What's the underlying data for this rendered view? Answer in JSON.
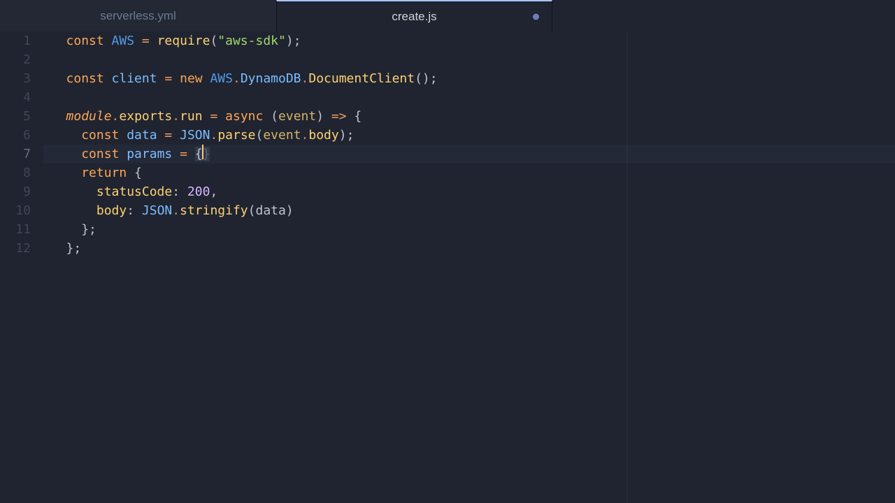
{
  "tabs": [
    {
      "label": "serverless.yml",
      "active": false,
      "dirty": false
    },
    {
      "label": "create.js",
      "active": true,
      "dirty": true
    }
  ],
  "gutter": {
    "lines": [
      "1",
      "2",
      "3",
      "4",
      "5",
      "6",
      "7",
      "8",
      "9",
      "10",
      "11",
      "12"
    ],
    "current": 7
  },
  "code": {
    "l1": {
      "kw": "const",
      "ident": "AWS",
      "eq": "=",
      "fn": "require",
      "lp": "(",
      "str": "\"aws-sdk\"",
      "rp": ")",
      "semi": ";"
    },
    "l3": {
      "kw": "const",
      "ident": "client",
      "eq": "=",
      "new": "new",
      "aws": "AWS",
      "d1": ".",
      "dyn": "DynamoDB",
      "d2": ".",
      "dc": "DocumentClient",
      "call": "()",
      "semi": ";"
    },
    "l5": {
      "mod": "module",
      "d1": ".",
      "exp": "exports",
      "d2": ".",
      "run": "run",
      "eq": "=",
      "async": "async",
      "lp": "(",
      "ev": "event",
      "rp": ")",
      "arrow": "=>",
      "brace": "{"
    },
    "l6": {
      "kw": "const",
      "ident": "data",
      "eq": "=",
      "json": "JSON",
      "d": ".",
      "parse": "parse",
      "lp": "(",
      "ev": "event",
      "d2": ".",
      "body": "body",
      "rp": ")",
      "semi": ";"
    },
    "l7": {
      "kw": "const",
      "ident": "params",
      "eq": "=",
      "lb": "{",
      "rb": "}"
    },
    "l8": {
      "ret": "return",
      "brace": "{"
    },
    "l9": {
      "key": "statusCode",
      "colon": ":",
      "num": "200",
      "comma": ","
    },
    "l10": {
      "key": "body",
      "colon": ":",
      "json": "JSON",
      "d": ".",
      "fn": "stringify",
      "lp": "(",
      "arg": "data",
      "rp": ")"
    },
    "l11": {
      "rb": "}",
      "semi": ";"
    },
    "l12": {
      "rb": "}",
      "semi": ";"
    }
  }
}
